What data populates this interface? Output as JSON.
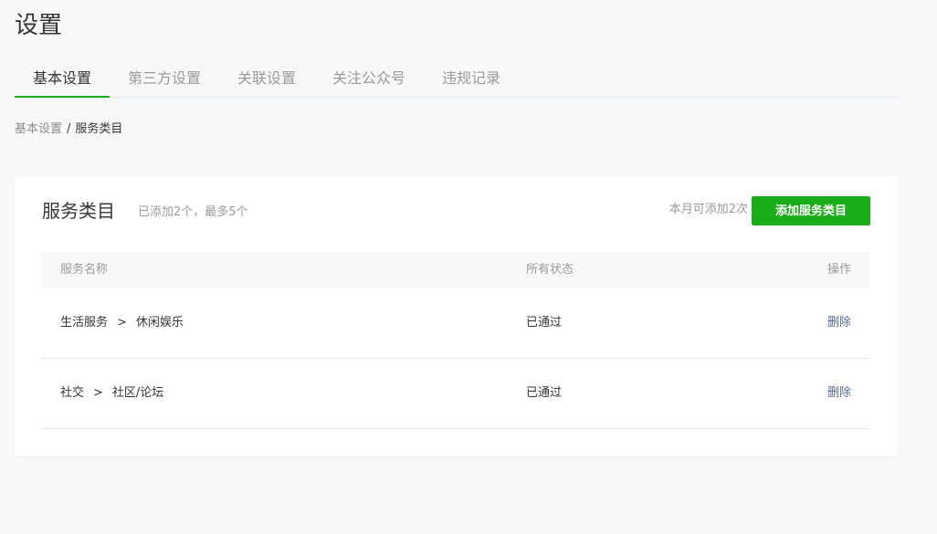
{
  "page": {
    "title": "设置"
  },
  "tabs": [
    {
      "label": "基本设置",
      "active": true
    },
    {
      "label": "第三方设置",
      "active": false
    },
    {
      "label": "关联设置",
      "active": false
    },
    {
      "label": "关注公众号",
      "active": false
    },
    {
      "label": "违规记录",
      "active": false
    }
  ],
  "breadcrumb": {
    "parent": "基本设置",
    "separator": "/",
    "current": "服务类目"
  },
  "card": {
    "title": "服务类目",
    "subtitle": "已添加2个，最多5个",
    "month_quota": "本月可添加2次",
    "add_button": "添加服务类目"
  },
  "table": {
    "headers": {
      "name": "服务名称",
      "status": "所有状态",
      "op": "操作"
    },
    "rows": [
      {
        "category": "生活服务",
        "arrow": ">",
        "sub": "休闲娱乐",
        "status": "已通过",
        "op": "删除"
      },
      {
        "category": "社交",
        "arrow": ">",
        "sub": "社区/论坛",
        "status": "已通过",
        "op": "删除"
      }
    ]
  },
  "colors": {
    "accent": "#1aad19",
    "link": "#576b95",
    "background": "#f7f8fa"
  }
}
